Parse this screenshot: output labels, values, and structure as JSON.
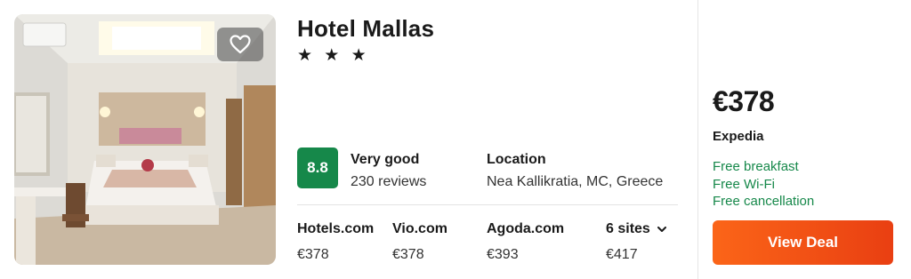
{
  "hotel": {
    "name": "Hotel Mallas",
    "stars": "★ ★ ★",
    "star_count": 3
  },
  "icons": {
    "favorite": "heart-outline-icon",
    "sites_toggle": "chevron-down-icon"
  },
  "rating": {
    "score": "8.8",
    "label": "Very good",
    "reviews": "230 reviews",
    "badge_color": "#16884a"
  },
  "location": {
    "title": "Location",
    "value": "Nea Kallikratia, MC, Greece"
  },
  "providers": [
    {
      "name": "Hotels.com",
      "price": "€378"
    },
    {
      "name": "Vio.com",
      "price": "€378"
    },
    {
      "name": "Agoda.com",
      "price": "€393"
    }
  ],
  "more_sites": {
    "label": "6 sites",
    "price": "€417"
  },
  "deal": {
    "price": "€378",
    "provider": "Expedia",
    "perks": [
      "Free breakfast",
      "Free Wi-Fi",
      "Free cancellation"
    ],
    "button_label": "View Deal",
    "perk_color": "#16884a",
    "button_color": "#f55a16"
  }
}
